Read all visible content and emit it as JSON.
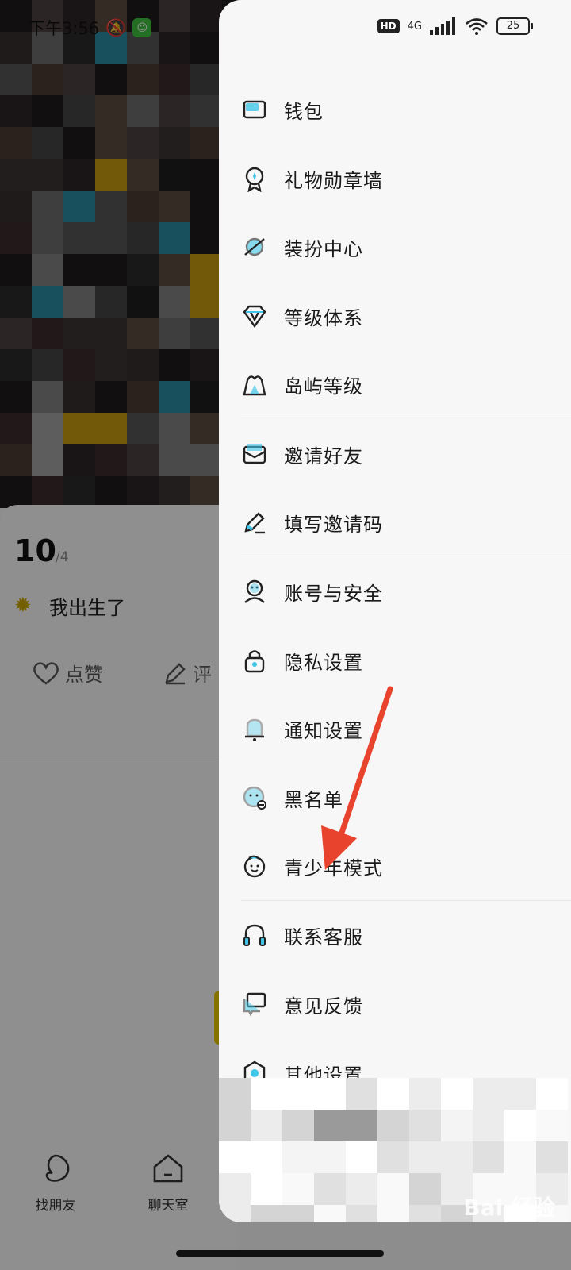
{
  "status_bar": {
    "time": "下午3:56",
    "hd_badge": "HD",
    "network": "4G",
    "battery": "25"
  },
  "background_page": {
    "date_day": "10",
    "date_month": "/4",
    "post_text": "我出生了",
    "like_label": "点赞",
    "comment_label": "评",
    "tabs": [
      {
        "label": "找朋友",
        "icon": "moon-icon"
      },
      {
        "label": "聊天室",
        "icon": "house-icon"
      }
    ]
  },
  "drawer": {
    "items": [
      {
        "label": "钱包",
        "icon": "wallet-icon"
      },
      {
        "label": "礼物勋章墙",
        "icon": "medal-icon"
      },
      {
        "label": "装扮中心",
        "icon": "planet-icon"
      },
      {
        "label": "等级体系",
        "icon": "diamond-v-icon"
      },
      {
        "label": "岛屿等级",
        "icon": "island-icon"
      },
      {
        "label": "邀请好友",
        "icon": "envelope-icon"
      },
      {
        "label": "填写邀请码",
        "icon": "pencil-icon"
      },
      {
        "label": "账号与安全",
        "icon": "user-shield-icon"
      },
      {
        "label": "隐私设置",
        "icon": "lock-icon"
      },
      {
        "label": "通知设置",
        "icon": "bell-icon"
      },
      {
        "label": "黑名单",
        "icon": "blocked-user-icon"
      },
      {
        "label": "青少年模式",
        "icon": "child-face-icon"
      },
      {
        "label": "联系客服",
        "icon": "headset-icon"
      },
      {
        "label": "意见反馈",
        "icon": "feedback-icon"
      },
      {
        "label": "其他设置",
        "icon": "hexagon-settings-icon"
      }
    ]
  },
  "watermark": "Bai 经验",
  "colors": {
    "accent": "#3ec6e8",
    "annotation_arrow": "#e8432c",
    "drawer_bg": "#f7f7f7"
  }
}
